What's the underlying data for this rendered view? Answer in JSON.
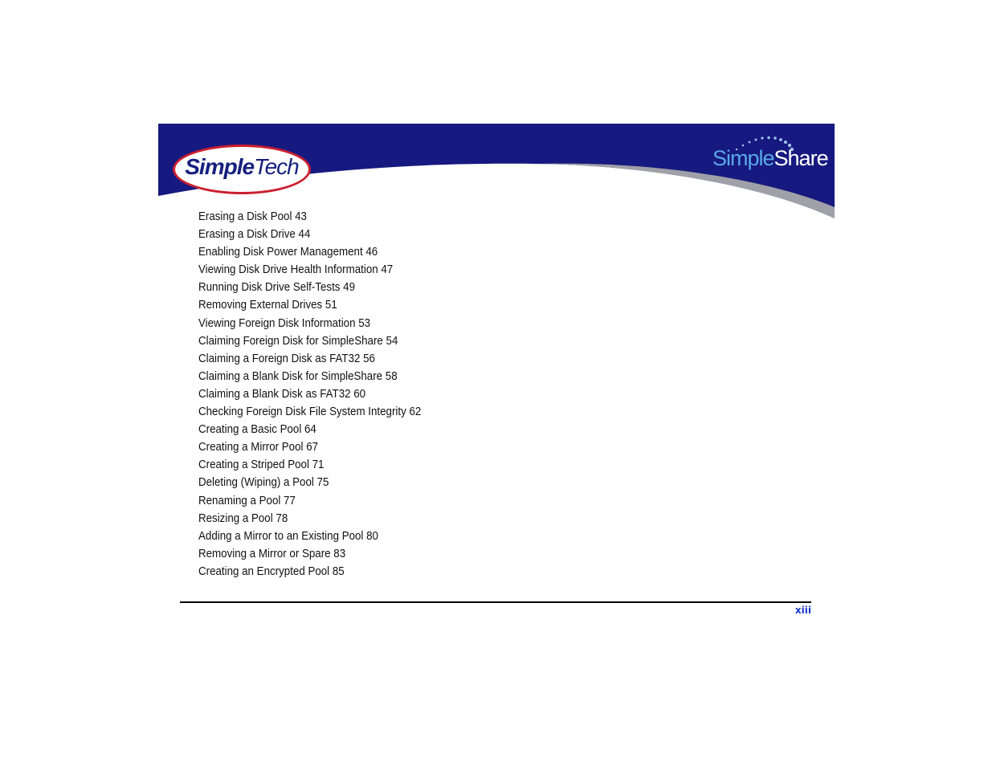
{
  "header": {
    "left_logo": {
      "brand_a": "S",
      "brand_i": "i",
      "brand_mple": "mple",
      "brand_tech": "Tech"
    },
    "right_logo": {
      "part_a": "Simple",
      "part_b": "Share"
    },
    "colors": {
      "banner_blue": "#16197f",
      "swoosh_gray": "#a0a0a8",
      "logo_red": "#cc1f2f",
      "share_light_blue": "#5aa7e6"
    }
  },
  "toc": {
    "entries": [
      {
        "title": "Erasing a Disk Pool",
        "page": "43"
      },
      {
        "title": "Erasing a Disk Drive",
        "page": "44"
      },
      {
        "title": "Enabling Disk Power Management",
        "page": "46"
      },
      {
        "title": "Viewing Disk Drive Health Information",
        "page": "47"
      },
      {
        "title": "Running Disk Drive Self-Tests",
        "page": "49"
      },
      {
        "title": "Removing External Drives",
        "page": "51"
      },
      {
        "title": "Viewing Foreign Disk Information",
        "page": "53"
      },
      {
        "title": "Claiming Foreign Disk for SimpleShare",
        "page": "54"
      },
      {
        "title": "Claiming a Foreign Disk as FAT32",
        "page": "56"
      },
      {
        "title": "Claiming a Blank Disk for SimpleShare",
        "page": "58"
      },
      {
        "title": "Claiming a Blank Disk as FAT32",
        "page": "60"
      },
      {
        "title": "Checking Foreign Disk File System Integrity",
        "page": "62"
      },
      {
        "title": "Creating a Basic Pool",
        "page": "64"
      },
      {
        "title": "Creating a Mirror Pool",
        "page": "67"
      },
      {
        "title": "Creating a Striped Pool",
        "page": "71"
      },
      {
        "title": "Deleting (Wiping) a Pool",
        "page": "75"
      },
      {
        "title": "Renaming a Pool",
        "page": "77"
      },
      {
        "title": "Resizing a Pool",
        "page": "78"
      },
      {
        "title": "Adding a Mirror to an Existing Pool",
        "page": "80"
      },
      {
        "title": "Removing a Mirror or Spare",
        "page": "83"
      },
      {
        "title": "Creating an Encrypted Pool",
        "page": "85"
      }
    ]
  },
  "footer": {
    "page_number": "xiii",
    "page_number_color": "#1a3ccc"
  }
}
